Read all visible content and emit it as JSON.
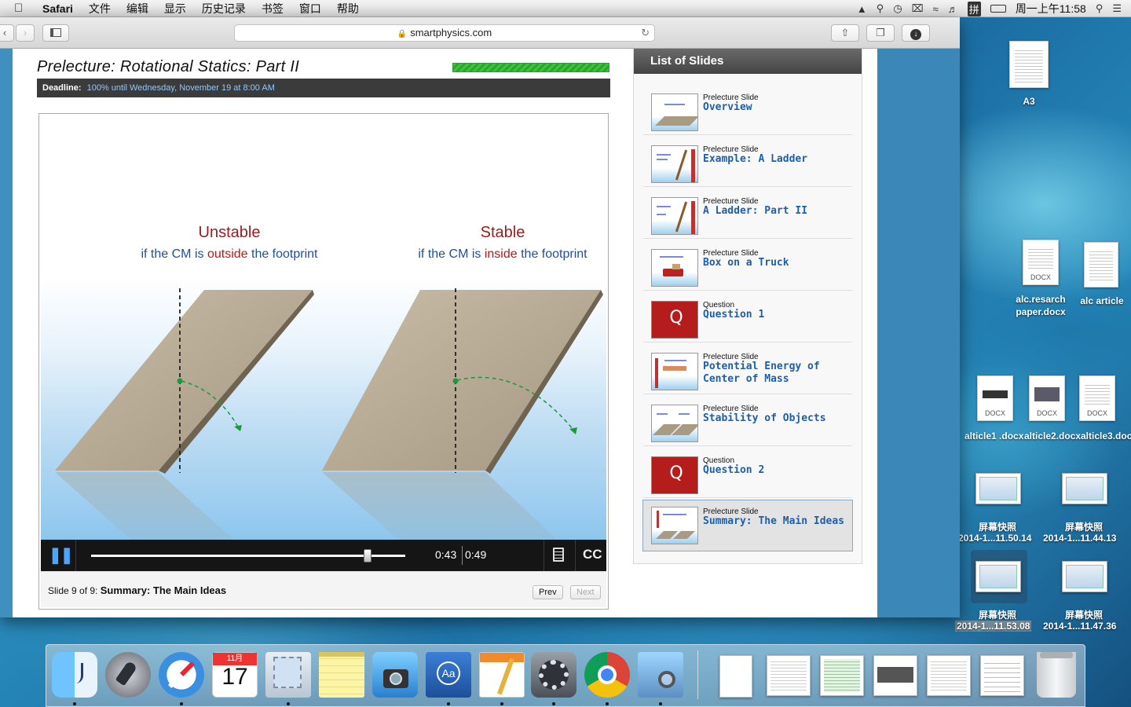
{
  "menubar": {
    "app": "Safari",
    "menus": [
      "文件",
      "编辑",
      "显示",
      "历史记录",
      "书签",
      "窗口",
      "帮助"
    ],
    "clock": "周一上午11:58",
    "input_method": "拼"
  },
  "browser": {
    "url": "smartphysics.com"
  },
  "lecture": {
    "title": "Prelecture: Rotational Statics: Part II",
    "deadline_label": "Deadline:",
    "deadline_value": "100% until Wednesday, November 19 at 8:00 AM",
    "progress_fraction": 1.0
  },
  "slide": {
    "left_heading": "Unstable",
    "left_sub_a": "if the CM is ",
    "left_sub_b": "outside",
    "left_sub_c": " the footprint",
    "right_heading": "Stable",
    "right_sub_a": "if the CM is ",
    "right_sub_b": "inside",
    "right_sub_c": " the footprint"
  },
  "player": {
    "current_time": "0:43",
    "total_time": "0:49",
    "playback_fraction": 0.88,
    "cc_label": "CC"
  },
  "footer": {
    "slide_prefix": "Slide 9 of 9: ",
    "slide_name": "Summary: The Main Ideas",
    "prev_label": "Prev",
    "next_label": "Next"
  },
  "slides_list": {
    "header": "List of Slides",
    "items": [
      {
        "kind": "Prelecture Slide",
        "title": "Overview",
        "thumb": "slab"
      },
      {
        "kind": "Prelecture Slide",
        "title": "Example: A Ladder",
        "thumb": "ladder"
      },
      {
        "kind": "Prelecture Slide",
        "title": "A Ladder: Part II",
        "thumb": "ladder"
      },
      {
        "kind": "Prelecture Slide",
        "title": "Box on a Truck",
        "thumb": "truck"
      },
      {
        "kind": "Question",
        "title": "Question 1",
        "thumb": "question"
      },
      {
        "kind": "Prelecture Slide",
        "title": "Potential Energy of Center of Mass",
        "thumb": "energy"
      },
      {
        "kind": "Prelecture Slide",
        "title": "Stability of Objects",
        "thumb": "slab"
      },
      {
        "kind": "Question",
        "title": "Question 2",
        "thumb": "question"
      },
      {
        "kind": "Prelecture Slide",
        "title": "Summary: The Main Ideas",
        "thumb": "summary",
        "active": true
      }
    ]
  },
  "desktop": {
    "icons": [
      {
        "label": "A3"
      },
      {
        "label": "alc.resarch paper.docx",
        "tag": "DOCX"
      },
      {
        "label": "alc article"
      },
      {
        "label": "alticle1 .docx",
        "tag": "DOCX"
      },
      {
        "label": "alticle2.docx",
        "tag": "DOCX"
      },
      {
        "label": "alticle3.docx",
        "tag": "DOCX"
      },
      {
        "label": "屏幕快照",
        "sub": "2014-1...11.50.14"
      },
      {
        "label": "屏幕快照",
        "sub": "2014-1...11.44.13"
      },
      {
        "label": "屏幕快照",
        "sub": "2014-1...11.53.08"
      },
      {
        "label": "屏幕快照",
        "sub": "2014-1...11.47.36"
      }
    ]
  },
  "dock": {
    "calendar_month": "11月",
    "calendar_day": "17",
    "apps": [
      "Finder",
      "Launchpad",
      "Safari",
      "Calendar",
      "Mail",
      "Notes",
      "iPhoto",
      "Dictionary",
      "Pages",
      "System Preferences",
      "Chrome",
      "Preview"
    ]
  }
}
